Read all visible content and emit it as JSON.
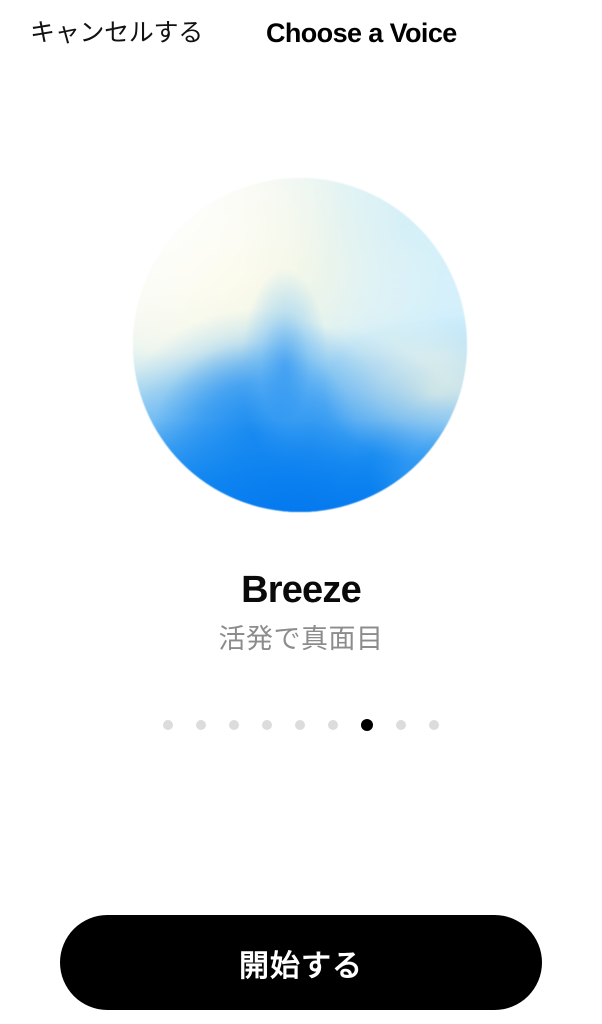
{
  "header": {
    "cancel_label": "キャンセルする",
    "title": "Choose a Voice"
  },
  "voice": {
    "orb_icon": "voice-orb-gradient",
    "name": "Breeze",
    "description": "活発で真面目",
    "colors": {
      "blue": "#0a84f0",
      "light_cyan": "#e2f5fb",
      "cream": "#fcf8d6",
      "white": "#ffffff"
    }
  },
  "pagination": {
    "total": 9,
    "active_index": 6,
    "dots": [
      {
        "label": ""
      },
      {
        "label": ""
      },
      {
        "label": ""
      },
      {
        "label": ""
      },
      {
        "label": ""
      },
      {
        "label": ""
      },
      {
        "label": ""
      },
      {
        "label": ""
      },
      {
        "label": ""
      }
    ],
    "inactive_color": "#dcdcdc",
    "active_color": "#000000"
  },
  "footer": {
    "start_label": "開始する",
    "button_bg": "#000000",
    "button_text_color": "#ffffff"
  }
}
